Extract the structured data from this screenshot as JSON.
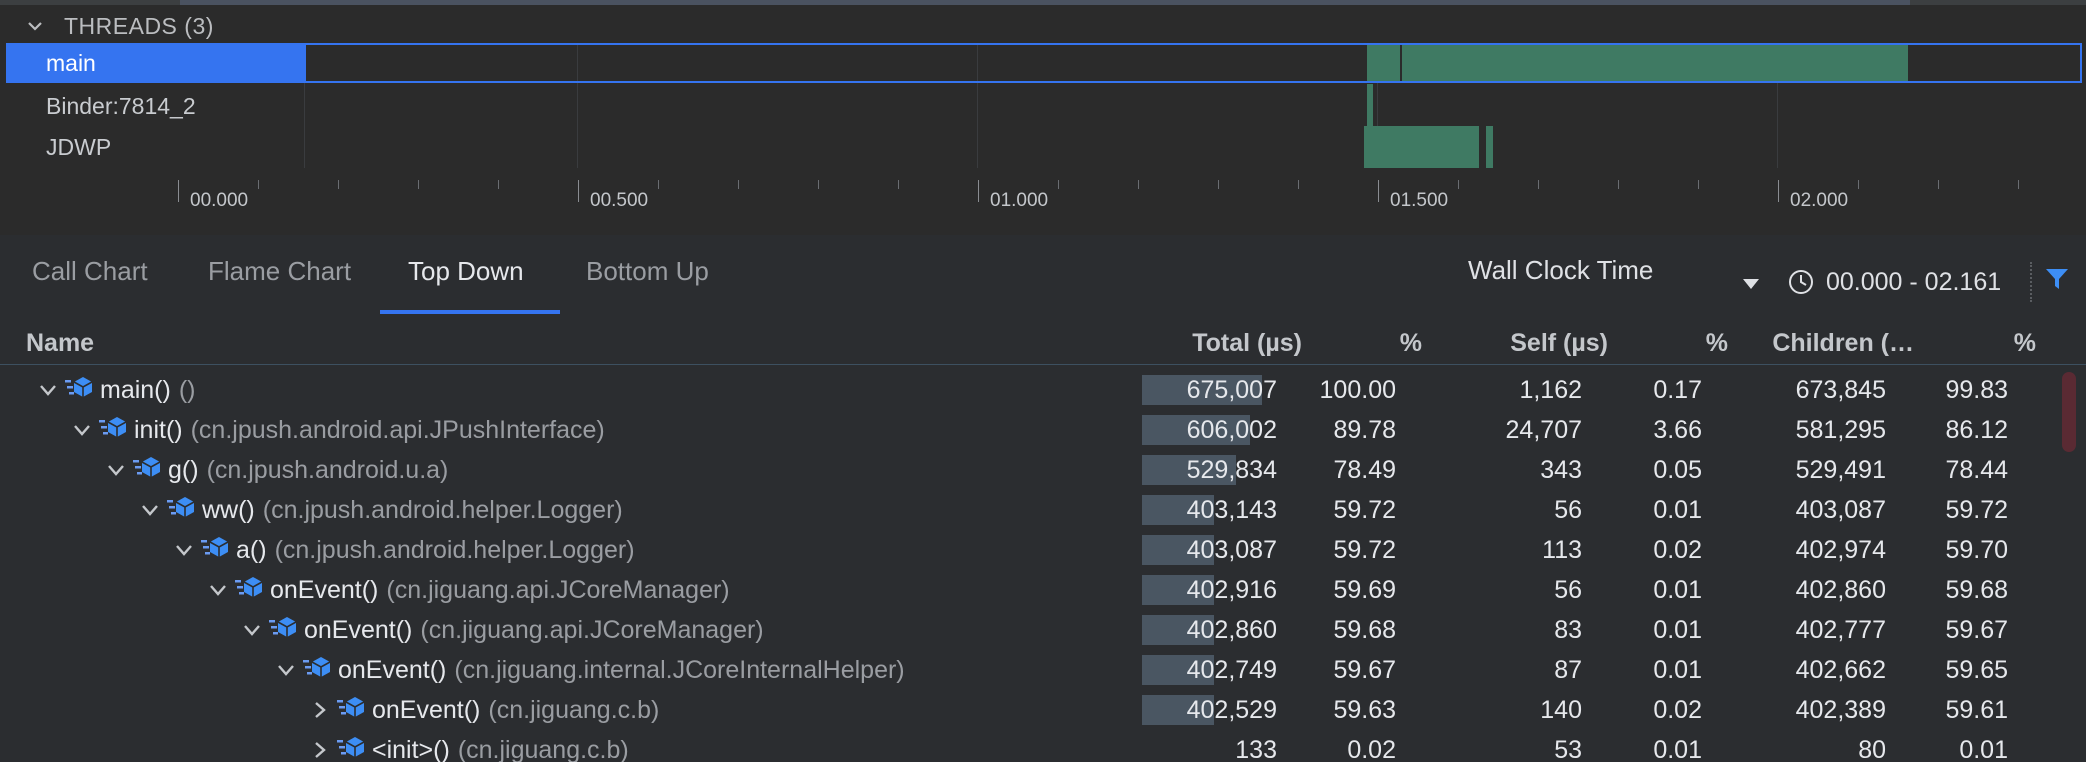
{
  "threads": {
    "header": "THREADS (3)",
    "items": [
      {
        "label": "main"
      },
      {
        "label": "Binder:7814_2"
      },
      {
        "label": "JDWP"
      }
    ]
  },
  "ruler": {
    "labels": [
      "00.000",
      "00.500",
      "01.000",
      "01.500",
      "02.000"
    ]
  },
  "tabs": [
    {
      "label": "Call Chart",
      "active": false
    },
    {
      "label": "Flame Chart",
      "active": false
    },
    {
      "label": "Top Down",
      "active": true
    },
    {
      "label": "Bottom Up",
      "active": false
    }
  ],
  "toolbar": {
    "clock_mode": "Wall Clock Time",
    "range": "00.000 - 02.161"
  },
  "colors": {
    "accent": "#3574f0",
    "activity_bar": "#3f7a63",
    "heat_bar": "#4a5662"
  },
  "table": {
    "columns": {
      "name": "Name",
      "total": "Total (µs)",
      "total_pct": "%",
      "self": "Self (µs)",
      "self_pct": "%",
      "children": "Children (…",
      "children_pct": "%"
    },
    "rows": [
      {
        "fn": "main()",
        "cls": "()",
        "total": "675,007",
        "total_pct": "100.00",
        "self": "1,162",
        "self_pct": "0.17",
        "children": "673,845",
        "children_pct": "99.83"
      },
      {
        "fn": "init()",
        "cls": "(cn.jpush.android.api.JPushInterface)",
        "total": "606,002",
        "total_pct": "89.78",
        "self": "24,707",
        "self_pct": "3.66",
        "children": "581,295",
        "children_pct": "86.12"
      },
      {
        "fn": "g()",
        "cls": "(cn.jpush.android.u.a)",
        "total": "529,834",
        "total_pct": "78.49",
        "self": "343",
        "self_pct": "0.05",
        "children": "529,491",
        "children_pct": "78.44"
      },
      {
        "fn": "ww()",
        "cls": "(cn.jpush.android.helper.Logger)",
        "total": "403,143",
        "total_pct": "59.72",
        "self": "56",
        "self_pct": "0.01",
        "children": "403,087",
        "children_pct": "59.72"
      },
      {
        "fn": "a()",
        "cls": "(cn.jpush.android.helper.Logger)",
        "total": "403,087",
        "total_pct": "59.72",
        "self": "113",
        "self_pct": "0.02",
        "children": "402,974",
        "children_pct": "59.70"
      },
      {
        "fn": "onEvent()",
        "cls": "(cn.jiguang.api.JCoreManager)",
        "total": "402,916",
        "total_pct": "59.69",
        "self": "56",
        "self_pct": "0.01",
        "children": "402,860",
        "children_pct": "59.68"
      },
      {
        "fn": "onEvent()",
        "cls": "(cn.jiguang.api.JCoreManager)",
        "total": "402,860",
        "total_pct": "59.68",
        "self": "83",
        "self_pct": "0.01",
        "children": "402,777",
        "children_pct": "59.67"
      },
      {
        "fn": "onEvent()",
        "cls": "(cn.jiguang.internal.JCoreInternalHelper)",
        "total": "402,749",
        "total_pct": "59.67",
        "self": "87",
        "self_pct": "0.01",
        "children": "402,662",
        "children_pct": "59.65"
      },
      {
        "fn": "onEvent()",
        "cls": "(cn.jiguang.c.b)",
        "total": "402,529",
        "total_pct": "59.63",
        "self": "140",
        "self_pct": "0.02",
        "children": "402,389",
        "children_pct": "59.61"
      },
      {
        "fn": "<init>()",
        "cls": "(cn.jiguang.c.b)",
        "total": "133",
        "total_pct": "0.02",
        "self": "53",
        "self_pct": "0.01",
        "children": "80",
        "children_pct": "0.01"
      }
    ]
  }
}
